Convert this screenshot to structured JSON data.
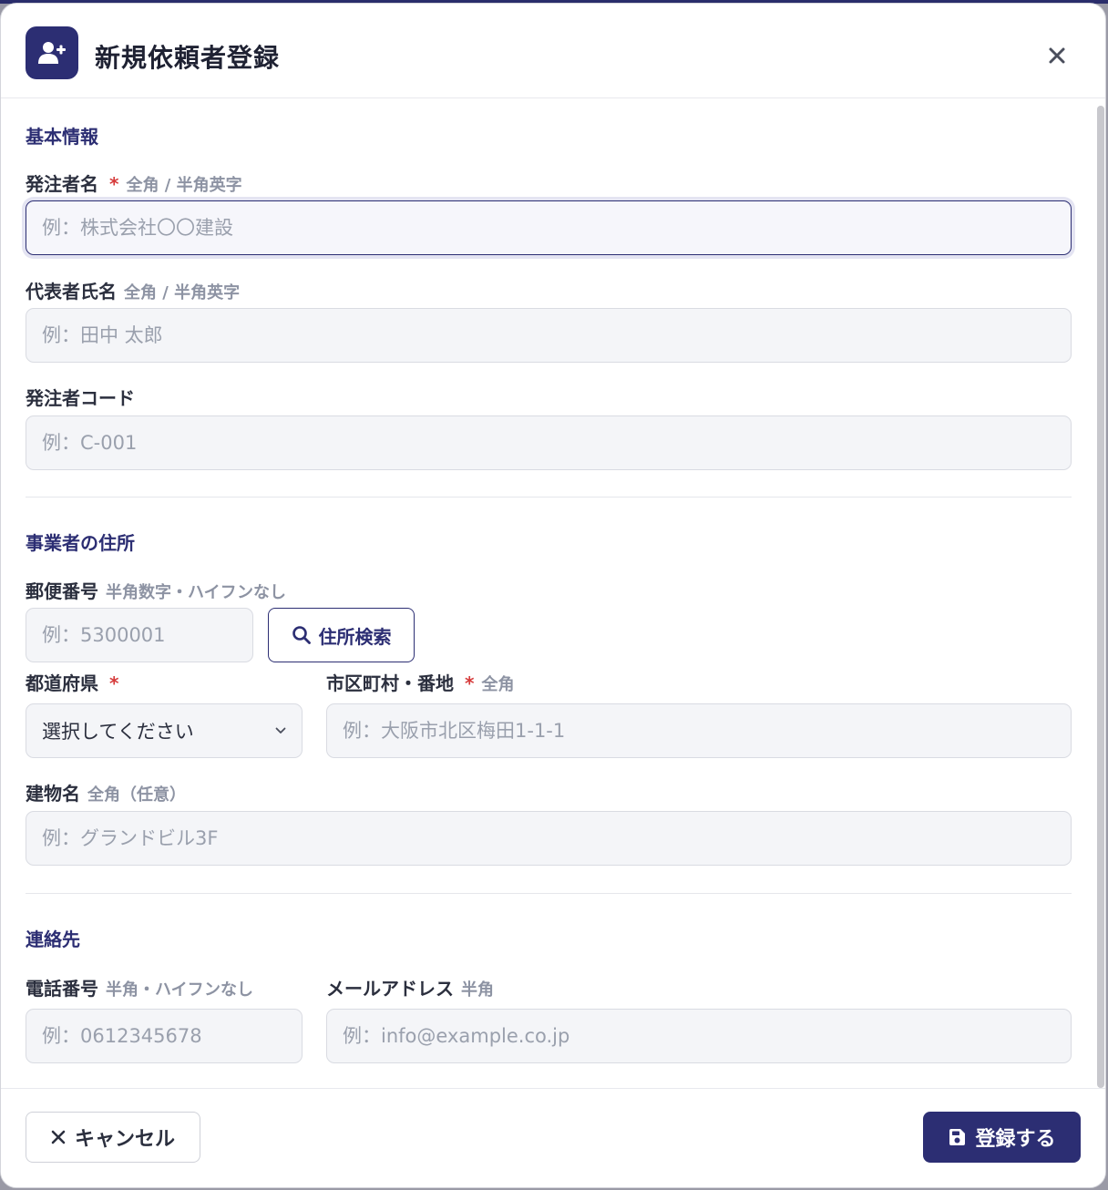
{
  "modal": {
    "title": "新規依頼者登録",
    "icon": "user-plus-icon",
    "accent_color": "#2c2e73",
    "required_color": "#d63b3b"
  },
  "sections": {
    "basic": "基本情報",
    "address": "事業者の住所",
    "contact": "連絡先"
  },
  "fields": {
    "client_name": {
      "label": "発注者名",
      "required": "*",
      "hint": "全角 / 半角英字",
      "placeholder": "例：株式会社〇〇建設"
    },
    "representative": {
      "label": "代表者氏名",
      "hint": "全角 / 半角英字",
      "placeholder": "例：田中 太郎"
    },
    "client_code": {
      "label": "発注者コード",
      "placeholder": "例：C-001"
    },
    "postal_code": {
      "label": "郵便番号",
      "hint": "半角数字・ハイフンなし",
      "placeholder": "例：5300001"
    },
    "address_search": {
      "label": "住所検索"
    },
    "prefecture": {
      "label": "都道府県",
      "required": "*",
      "selected": "選択してください"
    },
    "city": {
      "label": "市区町村・番地",
      "required": "*",
      "hint": "全角",
      "placeholder": "例：大阪市北区梅田1-1-1"
    },
    "building": {
      "label": "建物名",
      "hint": "全角（任意）",
      "placeholder": "例：グランドビル3F"
    },
    "phone": {
      "label": "電話番号",
      "hint": "半角・ハイフンなし",
      "placeholder": "例：0612345678"
    },
    "email": {
      "label": "メールアドレス",
      "hint": "半角",
      "placeholder": "例：info@example.co.jp"
    }
  },
  "footer": {
    "cancel_label": "キャンセル",
    "submit_label": "登録する"
  }
}
